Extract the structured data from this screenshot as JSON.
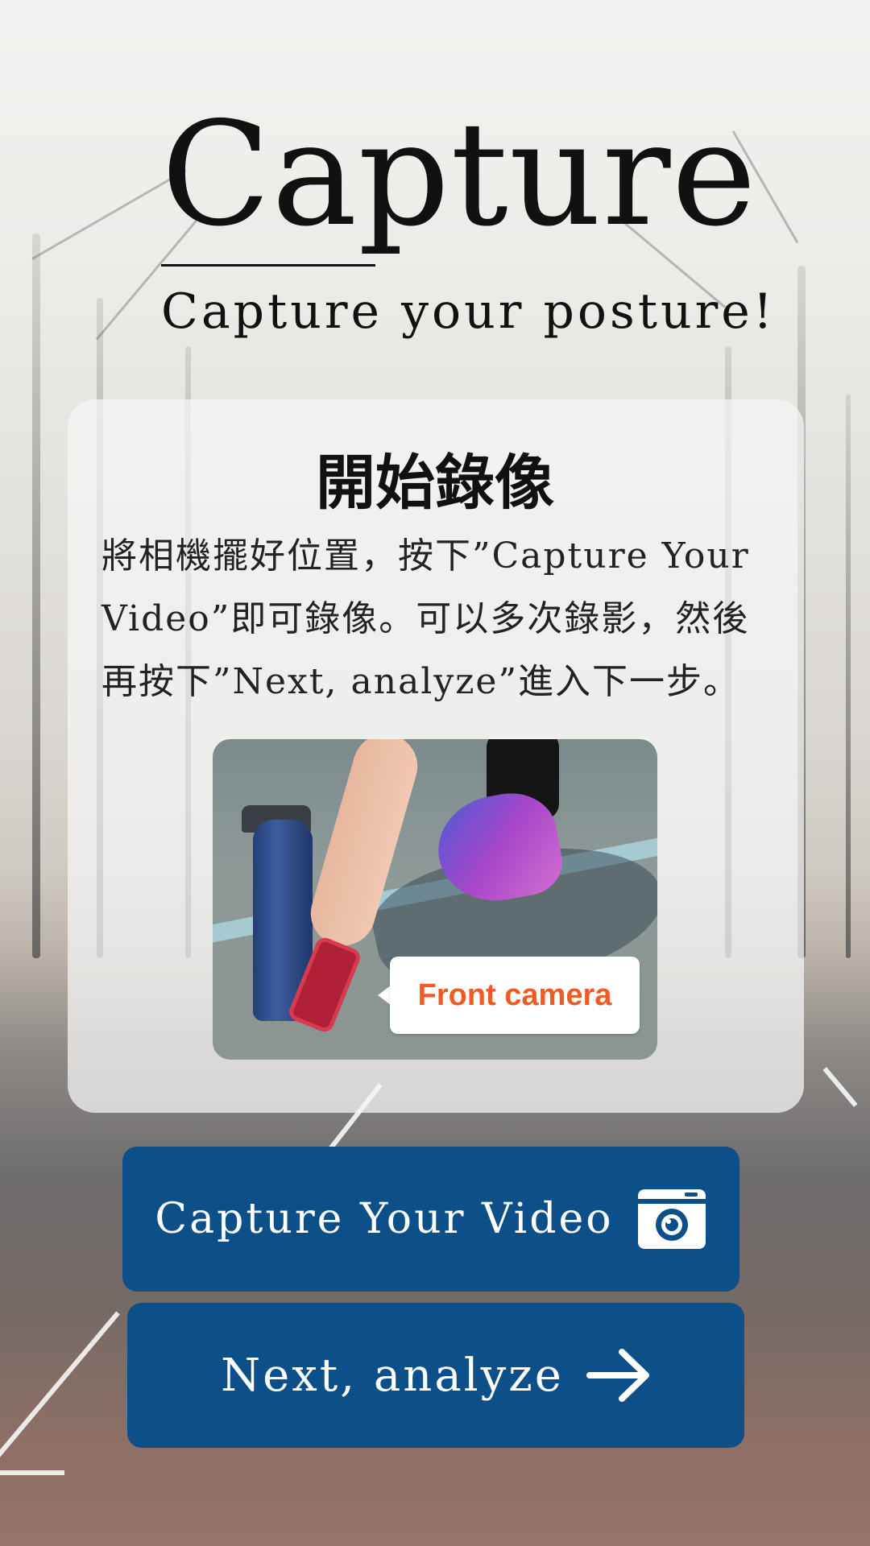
{
  "header": {
    "title": "Capture",
    "subtitle": "Capture your posture!"
  },
  "card": {
    "heading": "開始錄像",
    "description": "將相機擺好位置，按下”Capture Your Video”即可錄像。可以多次錄影，然後再按下”Next, analyze”進入下一步。",
    "demo_caption": "Front camera"
  },
  "buttons": {
    "capture_label": "Capture Your Video",
    "capture_icon": "camera-icon",
    "next_label": "Next, analyze",
    "next_icon": "arrow-right-icon"
  },
  "colors": {
    "button_bg": "#0d4f89",
    "caption": "#f05a24"
  }
}
